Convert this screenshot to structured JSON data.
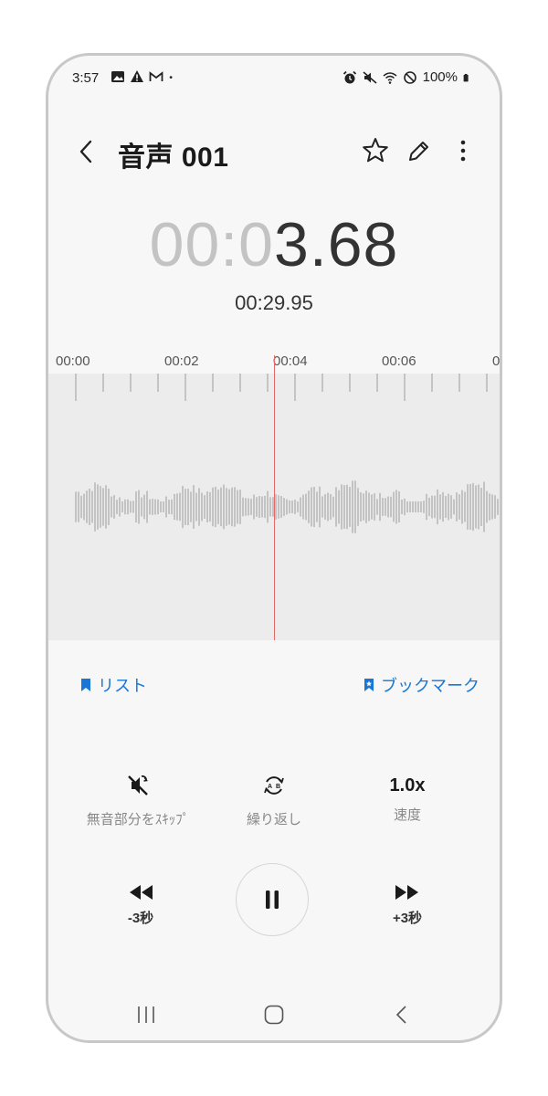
{
  "status_bar": {
    "time": "3:57",
    "battery": "100%",
    "left_icons": [
      "image-icon",
      "warning-icon",
      "gmail-icon",
      "dot-icon"
    ],
    "right_icons": [
      "alarm-icon",
      "mute-icon",
      "wifi-icon",
      "no-disturb-icon",
      "battery-icon"
    ]
  },
  "header": {
    "title": "音声 001",
    "buttons": [
      "back-icon",
      "star-icon",
      "pencil-icon",
      "more-vert-icon"
    ]
  },
  "timer": {
    "elapsed_dim": "00:0",
    "elapsed_main": "3.68",
    "total": "00:29.95"
  },
  "timeline": {
    "ticks": [
      "00:00",
      "00:02",
      "00:04",
      "00:06",
      "0"
    ]
  },
  "bookmarks": {
    "list_label": "リスト",
    "bookmark_label": "ブックマーク"
  },
  "controls": {
    "skip_silence_label": "無音部分をｽｷｯﾌﾟ",
    "repeat_label": "繰り返し",
    "speed_value": "1.0x",
    "speed_label": "速度",
    "rewind_label": "-3秒",
    "forward_label": "+3秒"
  },
  "colors": {
    "accent": "#1877d6",
    "playhead": "#e46a6a",
    "waveform": "#9a9a9a",
    "timer_dim": "#c3c3c3"
  }
}
